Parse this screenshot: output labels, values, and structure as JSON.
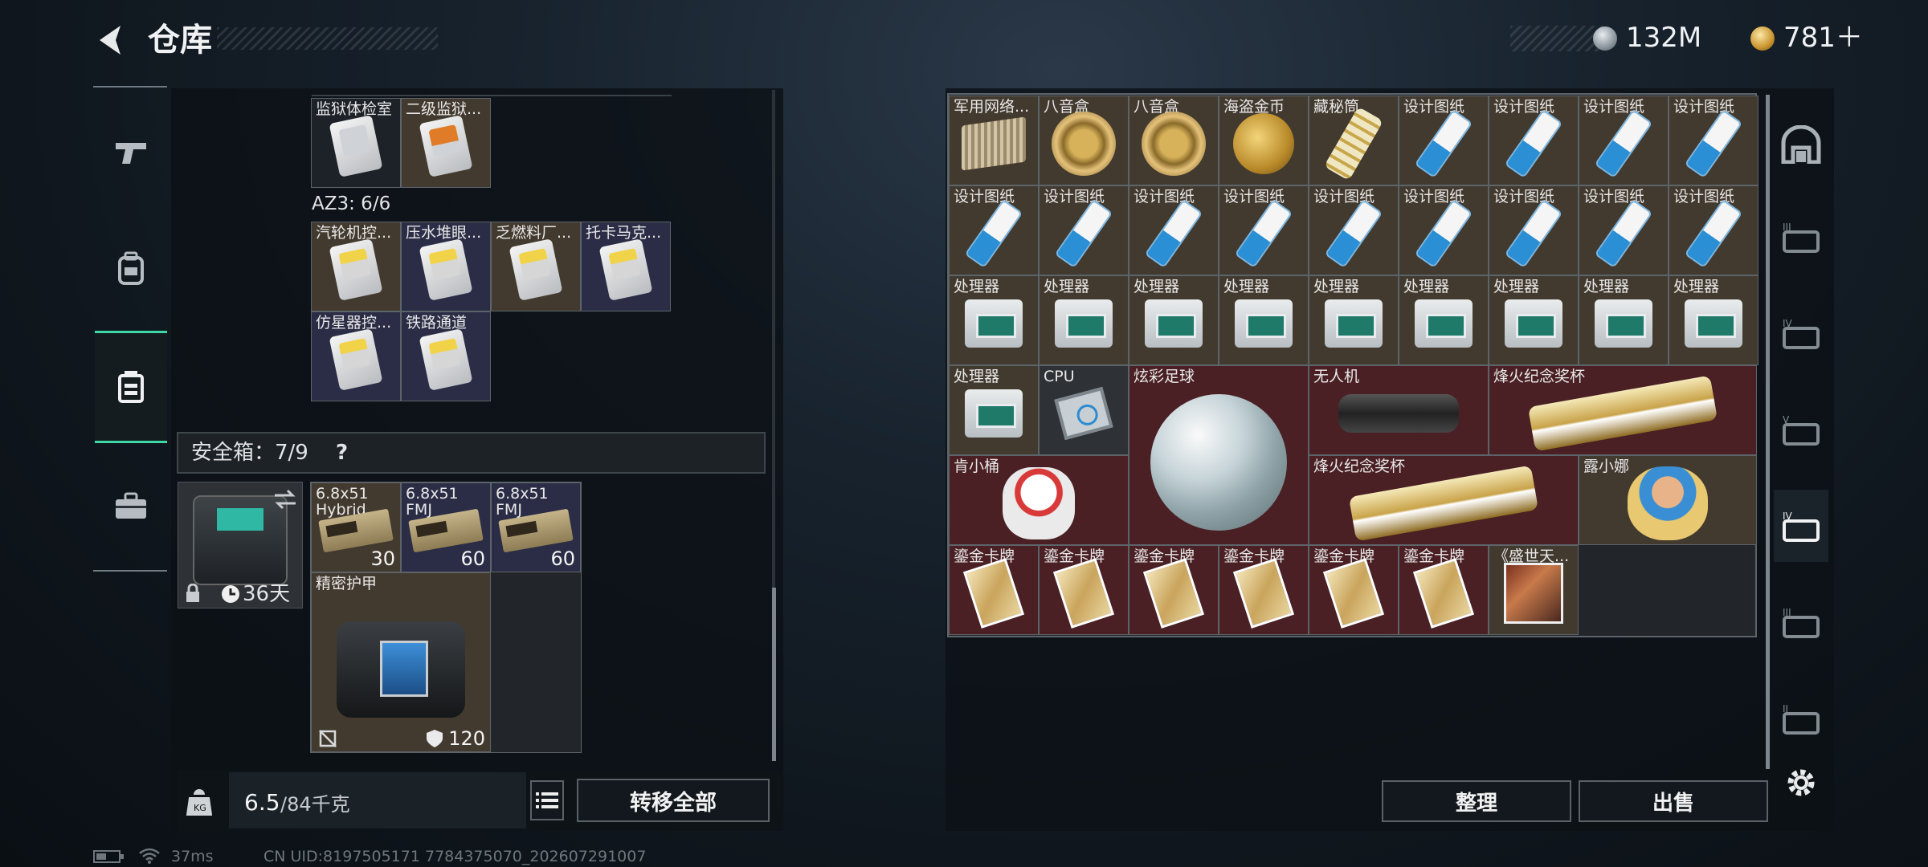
{
  "header": {
    "title": "仓库",
    "currency1": "132M",
    "currency2": "781＋"
  },
  "container_top": {
    "items": [
      {
        "label": "监狱体检室"
      },
      {
        "label": "二级监狱..."
      }
    ]
  },
  "az3": {
    "label": "AZ3: 6/6",
    "items": [
      {
        "label": "汽轮机控..."
      },
      {
        "label": "压水堆眼..."
      },
      {
        "label": "乏燃料厂..."
      },
      {
        "label": "托卡马克..."
      },
      {
        "label": "仿星器控..."
      },
      {
        "label": "铁路通道"
      }
    ]
  },
  "safe": {
    "label": "安全箱：7/9",
    "help": "?",
    "timer": "36天",
    "ammo": [
      {
        "line1": "6.8x51",
        "line2": "Hybrid",
        "qty": "30"
      },
      {
        "line1": "6.8x51",
        "line2": "FMJ",
        "qty": "60"
      },
      {
        "line1": "6.8x51",
        "line2": "FMJ",
        "qty": "60"
      }
    ],
    "armor": {
      "label": "精密护甲",
      "durability": "120"
    }
  },
  "footer": {
    "weight_main": "6.5",
    "weight_unit": "/84千克",
    "transfer_all": "转移全部"
  },
  "stash": {
    "row1": [
      "军用网络...",
      "八音盒",
      "八音盒",
      "海盗金币",
      "藏秘筒",
      "设计图纸",
      "设计图纸",
      "设计图纸",
      "设计图纸"
    ],
    "row2": [
      "设计图纸",
      "设计图纸",
      "设计图纸",
      "设计图纸",
      "设计图纸",
      "设计图纸",
      "设计图纸",
      "设计图纸",
      "设计图纸"
    ],
    "row3": [
      "处理器",
      "处理器",
      "处理器",
      "处理器",
      "处理器",
      "处理器",
      "处理器",
      "处理器",
      "处理器"
    ],
    "row4": {
      "proc": "处理器",
      "cpu": "CPU",
      "ball": "炫彩足球",
      "drone": "无人机",
      "trophy1": "烽火纪念奖杯"
    },
    "row5": {
      "figure": "肯小桶",
      "trophy2": "烽火纪念奖杯",
      "doll": "露小娜"
    },
    "row6": [
      "鎏金卡牌",
      "鎏金卡牌",
      "鎏金卡牌",
      "鎏金卡牌",
      "鎏金卡牌",
      "鎏金卡牌",
      "《盛世天..."
    ],
    "sort": "整理",
    "sell": "出售"
  },
  "status": {
    "ping": "37ms",
    "uid": "CN UID:8197505171 7784375070_202607291007"
  }
}
